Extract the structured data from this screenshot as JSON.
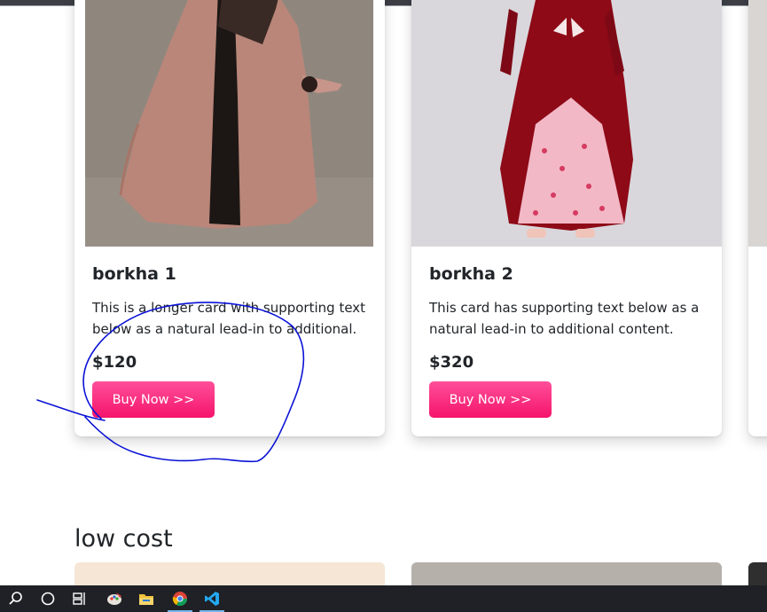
{
  "products": [
    {
      "title": "borkha 1",
      "text": "This is a longer card with supporting text below as a natural lead-in to additional.",
      "price": "$120",
      "button": "Buy Now >>"
    },
    {
      "title": "borkha 2",
      "text": "This card has supporting text below as a natural lead-in to additional content.",
      "price": "$320",
      "button": "Buy Now >>"
    }
  ],
  "section": {
    "heading": "low cost"
  },
  "colors": {
    "button": "#f5146b",
    "annotation": "#0a12d6",
    "taskbar": "#1f2126"
  },
  "taskbar": {
    "icons": [
      "search-icon",
      "cortana-icon",
      "task-view-icon",
      "paint-icon",
      "file-explorer-icon",
      "chrome-icon",
      "vscode-icon"
    ]
  }
}
